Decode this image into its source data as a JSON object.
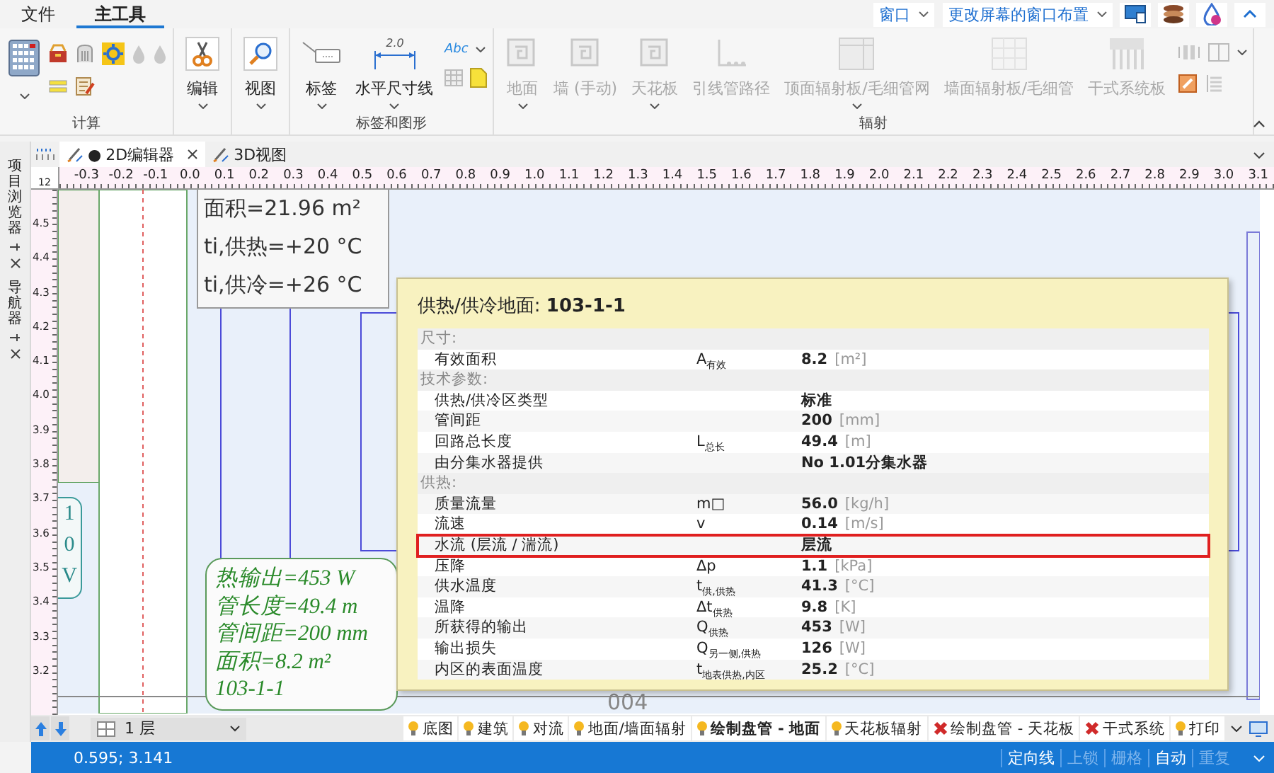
{
  "menu_tabs": [
    {
      "label": "文件",
      "selected": false
    },
    {
      "label": "主工具",
      "selected": true
    }
  ],
  "window_menu": {
    "label": "窗口"
  },
  "layout_menu": {
    "label": "更改屏幕的窗口布置"
  },
  "ribbon_groups": [
    {
      "title": "计算",
      "buttons": [
        {
          "kind": "calc",
          "disabled": false,
          "dropdown": true
        }
      ]
    },
    {
      "buttons": [
        {
          "kind": "edit",
          "label": "编辑",
          "disabled": false,
          "dropdown": true
        }
      ]
    },
    {
      "buttons": [
        {
          "kind": "view",
          "label": "视图",
          "disabled": false,
          "dropdown": true
        }
      ]
    },
    {
      "title": "标签和图形",
      "buttons": [
        {
          "kind": "tag",
          "label": "标签",
          "disabled": false,
          "dropdown": true
        },
        {
          "kind": "dimension",
          "label": "水平尺寸线",
          "glyph": "2.0",
          "disabled": false,
          "dropdown": true
        },
        {
          "kind": "text-tools",
          "glyph": "Abc",
          "disabled": false,
          "dropdown": true
        }
      ]
    },
    {
      "title": "辐射",
      "buttons": [
        {
          "kind": "panel",
          "label": "地面",
          "disabled": true,
          "dropdown": true
        },
        {
          "kind": "wall",
          "label": "墙 (手动)",
          "disabled": true,
          "dropdown": false
        },
        {
          "kind": "panel",
          "label": "天花板",
          "disabled": true,
          "dropdown": true
        },
        {
          "kind": "route",
          "label": "引线管路径",
          "disabled": true,
          "dropdown": false
        },
        {
          "kind": "ceiling",
          "label": "顶面辐射板/毛细管网",
          "disabled": true,
          "dropdown": true
        },
        {
          "kind": "grid",
          "label": "墙面辐射板/毛细管",
          "disabled": true,
          "dropdown": false
        },
        {
          "kind": "rack",
          "label": "干式系统板",
          "disabled": true,
          "dropdown": false
        },
        {
          "kind": "tools",
          "disabled": true,
          "dropdown": true
        }
      ]
    }
  ],
  "side_panels": [
    {
      "label": "项目浏览器"
    },
    {
      "label": "导航器"
    }
  ],
  "doc_tabs": [
    {
      "label": "2D编辑器",
      "prefix": "●",
      "selected": true,
      "closable": true
    },
    {
      "label": "3D视图",
      "selected": false,
      "closable": false
    }
  ],
  "ruler": {
    "corner": "12",
    "x_labels": [
      "-0.3",
      "-0.2",
      "-0.1",
      "0.0",
      "0.1",
      "0.2",
      "0.3",
      "0.4",
      "0.5",
      "0.6",
      "0.7",
      "0.8",
      "0.9",
      "1.0",
      "1.1",
      "1.2",
      "1.3",
      "1.4",
      "1.5",
      "1.6",
      "1.7",
      "1.8",
      "1.9",
      "2.0",
      "2.1",
      "2.2",
      "2.3",
      "2.4",
      "2.5",
      "2.6",
      "2.7",
      "2.8",
      "2.9",
      "3.0",
      "3.1"
    ],
    "y_labels": [
      "4.5",
      "4.4",
      "4.3",
      "4.2",
      "4.1",
      "4.0",
      "3.9",
      "3.8",
      "3.7",
      "3.6",
      "3.5",
      "3.4",
      "3.3",
      "3.2"
    ]
  },
  "canvas": {
    "room_label": [
      "面积=21.96 m²",
      "ti,供热=+20 °C",
      "ti,供冷=+26 °C"
    ],
    "side_label": [
      "1",
      "0",
      "V"
    ],
    "circuit_label": [
      "热输出=453 W",
      "管长度=49.4 m",
      "管间距=200 mm",
      "面积=8.2 m²",
      "103-1-1"
    ],
    "room_number": "004"
  },
  "tooltip": {
    "title": "供热/供冷地面: ",
    "name": "103-1-1",
    "rows": [
      {
        "kind": "section",
        "label": "尺寸:",
        "highlighted": false
      },
      {
        "kind": "row",
        "label": "有效面积",
        "symbol": "A$_{有效}$",
        "value": "8.2",
        "unit": "[m²]",
        "highlighted": false
      },
      {
        "kind": "section",
        "label": "技术参数:",
        "highlighted": false
      },
      {
        "kind": "row",
        "label": "供热/供冷区类型",
        "value": "标准",
        "highlighted": false
      },
      {
        "kind": "row",
        "label": "管间距",
        "value": "200",
        "unit": "[mm]",
        "highlighted": false
      },
      {
        "kind": "row",
        "label": "回路总长度",
        "symbol": "L$_{总长}$",
        "value": "49.4",
        "unit": "[m]",
        "highlighted": false
      },
      {
        "kind": "row",
        "label": "由分集水器提供",
        "value": "No 1.01分集水器",
        "highlighted": false
      },
      {
        "kind": "section",
        "label": "供热:",
        "highlighted": false
      },
      {
        "kind": "row",
        "label": "质量流量",
        "symbol": "m□",
        "value": "56.0",
        "unit": "[kg/h]",
        "highlighted": false
      },
      {
        "kind": "row",
        "label": "流速",
        "symbol": "v",
        "value": "0.14",
        "unit": "[m/s]",
        "highlighted": false
      },
      {
        "kind": "row",
        "label": "水流 (层流 / 湍流)",
        "value": "层流",
        "highlighted": true
      },
      {
        "kind": "row",
        "label": "压降",
        "symbol": "Δp",
        "value": "1.1",
        "unit": "[kPa]",
        "highlighted": false
      },
      {
        "kind": "row",
        "label": "供水温度",
        "symbol": "t$_{供,供热}$",
        "value": "41.3",
        "unit": "[°C]",
        "highlighted": false
      },
      {
        "kind": "row",
        "label": "温降",
        "symbol": "Δt$_{供热}$",
        "value": "9.8",
        "unit": "[K]",
        "highlighted": false
      },
      {
        "kind": "row",
        "label": "所获得的输出",
        "symbol": "Q$_{供热}$",
        "value": "453",
        "unit": "[W]",
        "highlighted": false
      },
      {
        "kind": "row",
        "label": "输出损失",
        "symbol": "Q$_{另一侧,供热}$",
        "value": "126",
        "unit": "[W]",
        "highlighted": false
      },
      {
        "kind": "row",
        "label": "内区的表面温度",
        "symbol": "t$_{地表供热,内区}$",
        "value": "25.2",
        "unit": "[°C]",
        "highlighted": false
      }
    ]
  },
  "floor_select": {
    "value": "1 层"
  },
  "layer_tabs": [
    {
      "label": "底图",
      "kind": "bulb",
      "selected": false
    },
    {
      "label": "建筑",
      "kind": "bulb",
      "selected": false
    },
    {
      "label": "对流",
      "kind": "bulb",
      "selected": false
    },
    {
      "label": "地面/墙面辐射",
      "kind": "bulb",
      "selected": false
    },
    {
      "label": "绘制盘管 - 地面",
      "kind": "bulb",
      "selected": true
    },
    {
      "label": "天花板辐射",
      "kind": "bulb",
      "selected": false
    },
    {
      "label": "绘制盘管 - 天花板",
      "kind": "cross",
      "selected": false
    },
    {
      "label": "干式系统",
      "kind": "cross",
      "selected": false
    },
    {
      "label": "打印",
      "kind": "bulb",
      "selected": false
    }
  ],
  "status": {
    "coords": "0.595; 3.141",
    "toggles": [
      {
        "label": "定向线",
        "on": true
      },
      {
        "label": "上锁",
        "on": false
      },
      {
        "label": "栅格",
        "on": false
      },
      {
        "label": "自动",
        "on": true
      },
      {
        "label": "重复",
        "on": false
      }
    ]
  }
}
